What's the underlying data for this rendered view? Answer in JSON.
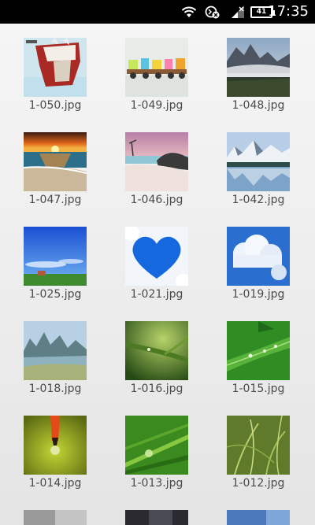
{
  "status_bar": {
    "time": "17:35",
    "battery_level": "41",
    "icons": [
      "wifi-icon",
      "sync-blocked-icon",
      "signal-icon",
      "battery-icon"
    ]
  },
  "gallery": {
    "items": [
      {
        "name": "1-050.jpg"
      },
      {
        "name": "1-049.jpg"
      },
      {
        "name": "1-048.jpg"
      },
      {
        "name": "1-047.jpg"
      },
      {
        "name": "1-046.jpg"
      },
      {
        "name": "1-042.jpg"
      },
      {
        "name": "1-025.jpg"
      },
      {
        "name": "1-021.jpg"
      },
      {
        "name": "1-019.jpg"
      },
      {
        "name": "1-018.jpg"
      },
      {
        "name": "1-016.jpg"
      },
      {
        "name": "1-015.jpg"
      },
      {
        "name": "1-014.jpg"
      },
      {
        "name": "1-013.jpg"
      },
      {
        "name": "1-012.jpg"
      }
    ]
  }
}
